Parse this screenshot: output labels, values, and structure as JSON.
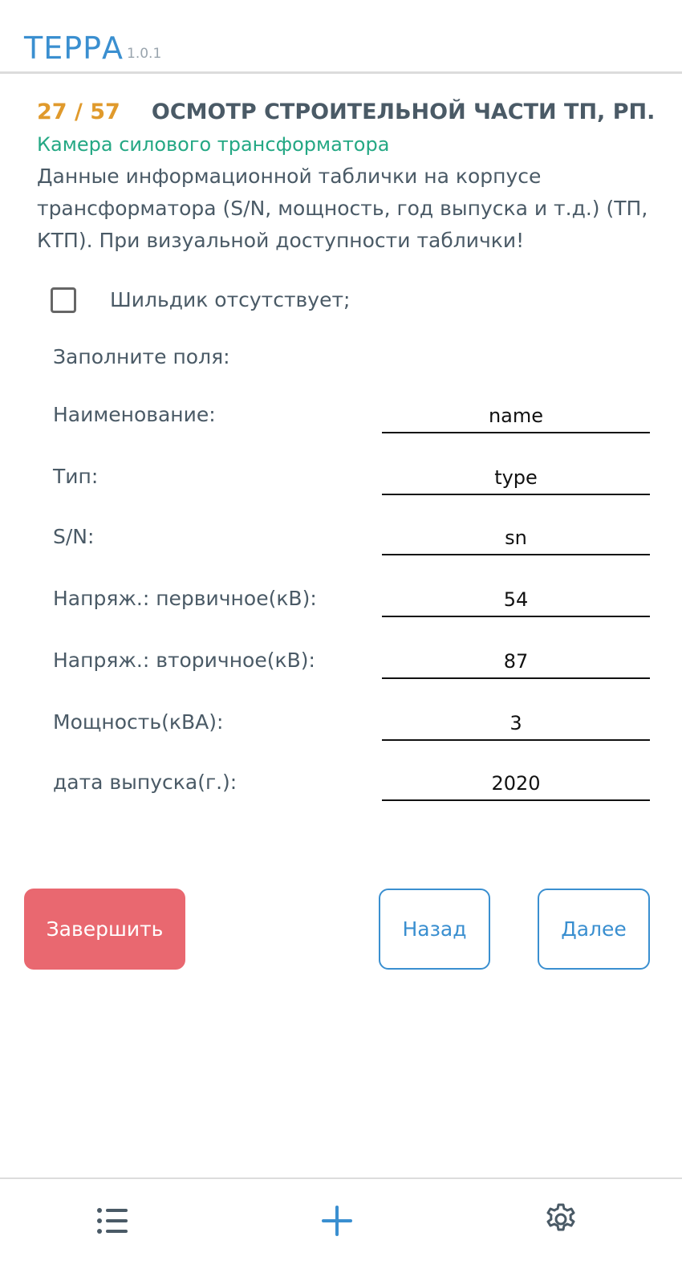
{
  "header": {
    "brand": "ТЕРРА",
    "version": "1.0.1"
  },
  "question": {
    "counter": "27 / 57",
    "title": "ОСМОТР СТРОИТЕЛЬНОЙ ЧАСТИ ТП, РП.",
    "subtitle": "Камера силового трансформатора",
    "description": "Данные информационной таблички на корпусе трансформатора (S/N, мощность, год выпуска и т.д.) (ТП, КТП). При визуальной доступности таблички!"
  },
  "checkbox": {
    "label": "Шильдик отсутствует;",
    "checked": false
  },
  "form": {
    "prompt": "Заполните поля:",
    "fields": [
      {
        "label": "Наименование:",
        "value": "name"
      },
      {
        "label": "Тип:",
        "value": "type"
      },
      {
        "label": "S/N:",
        "value": "sn"
      },
      {
        "label": "Напряж.: первичное(кВ):",
        "value": "54"
      },
      {
        "label": "Напряж.: вторичное(кВ):",
        "value": "87"
      },
      {
        "label": "Мощность(кВА):",
        "value": "3"
      },
      {
        "label": "дата выпуска(г.):",
        "value": "2020"
      }
    ]
  },
  "buttons": {
    "finish": "Завершить",
    "back": "Назад",
    "next": "Далее"
  },
  "bottom_nav": {
    "icons": [
      "list-icon",
      "plus-icon",
      "gear-icon"
    ]
  },
  "colors": {
    "accent": "#3a8fd0",
    "counter": "#e09a2c",
    "subtitle": "#24a884",
    "finish": "#e96870",
    "text": "#4a5a66"
  }
}
